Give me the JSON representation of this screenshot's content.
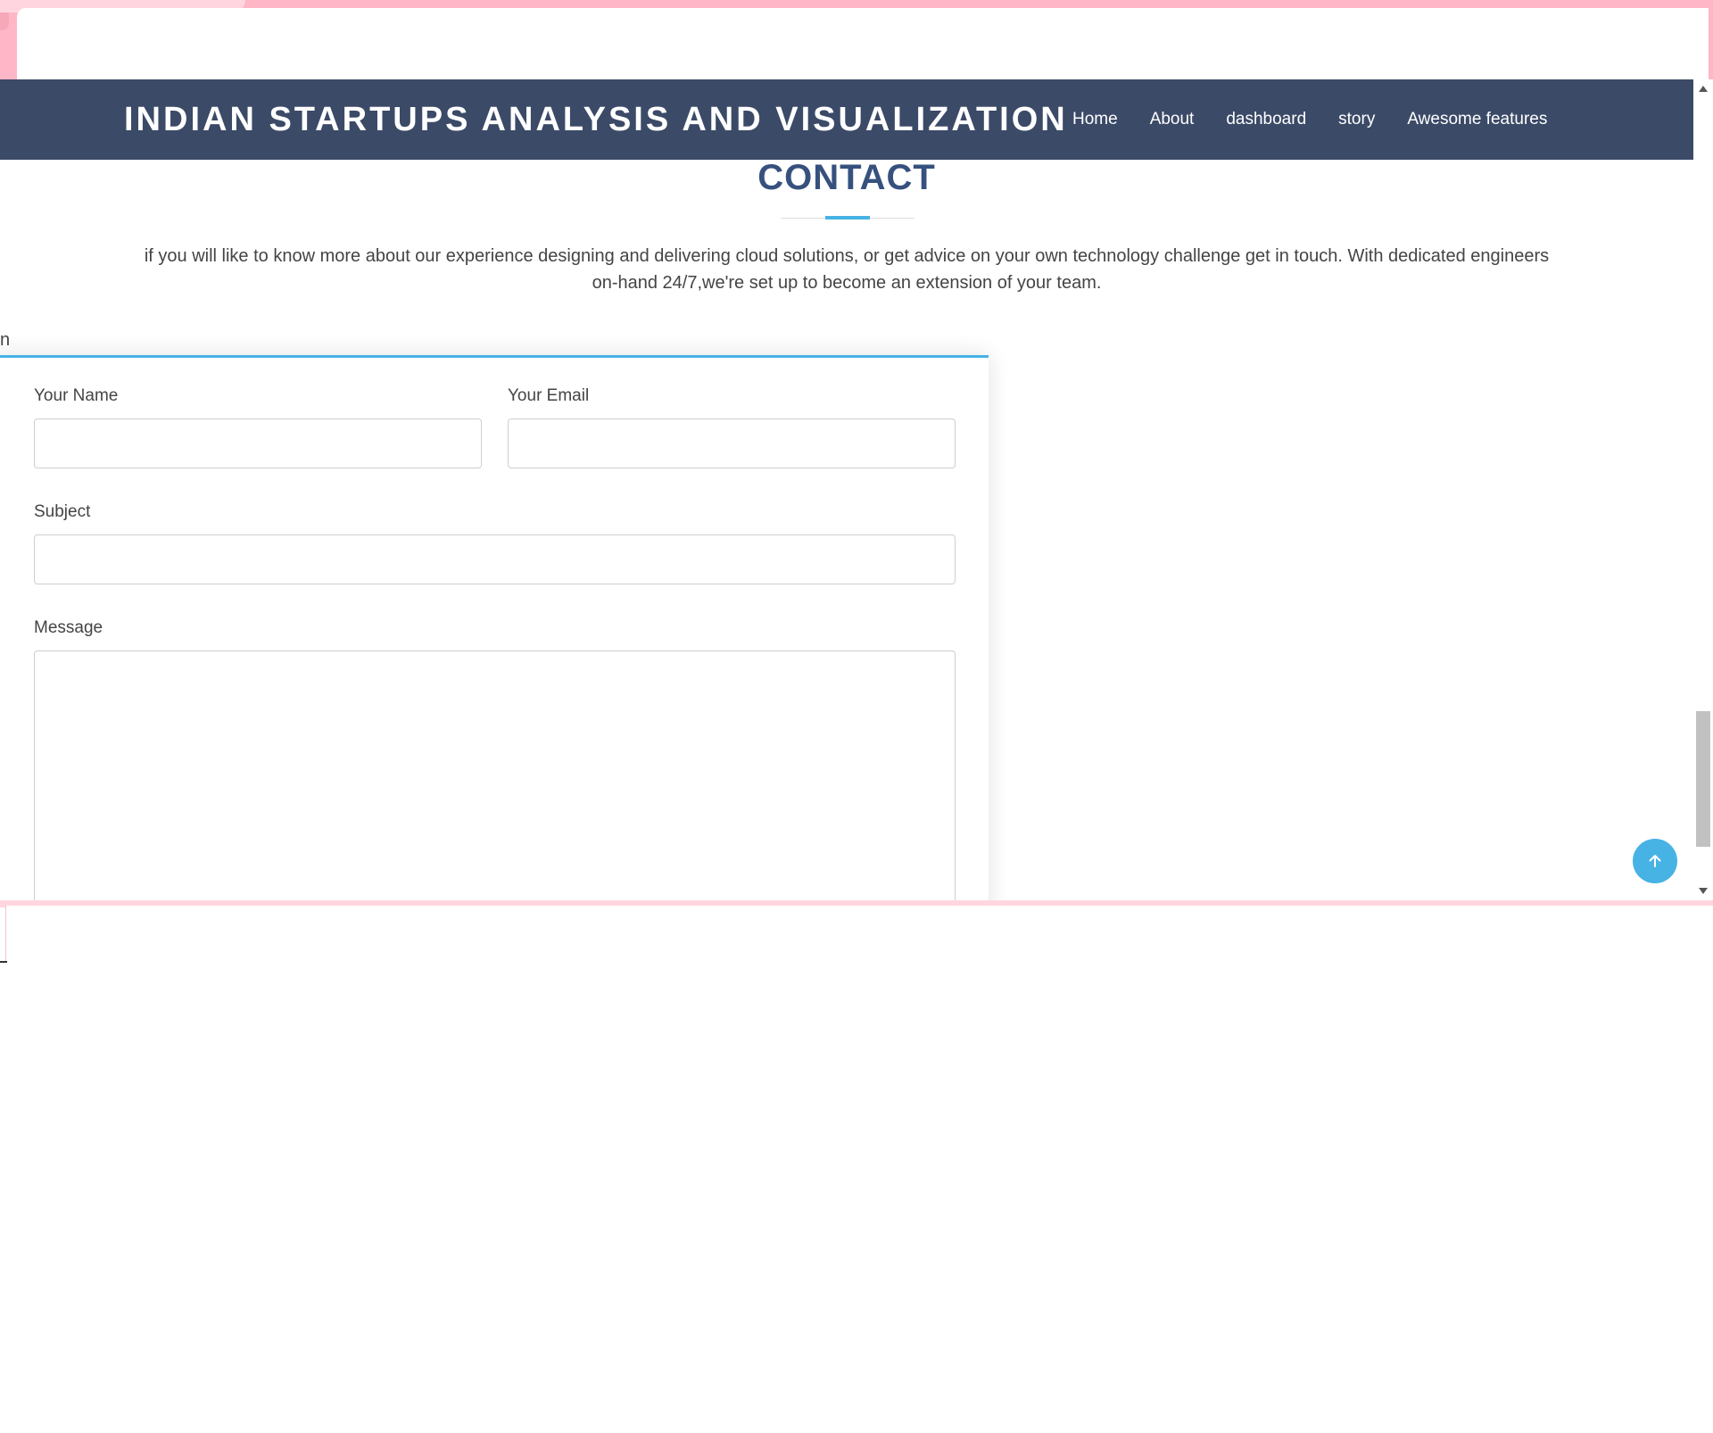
{
  "site": {
    "logo_text": "INDIAN STARTUPS ANALYSIS AND VISUALIZATION"
  },
  "nav": {
    "items": [
      {
        "label": "Home"
      },
      {
        "label": "About"
      },
      {
        "label": "dashboard"
      },
      {
        "label": "story"
      },
      {
        "label": "Awesome features"
      }
    ]
  },
  "contact": {
    "title": "CONTACT",
    "description": "if you will like to know more about our experience designing and delivering cloud solutions, or get advice on your own technology challenge get in touch. With dedicated engineers on-hand 24/7,we're set up to become an extension of your team.",
    "stray_text": "n"
  },
  "form": {
    "name": {
      "label": "Your Name",
      "value": ""
    },
    "email": {
      "label": "Your Email",
      "value": ""
    },
    "subject": {
      "label": "Subject",
      "value": ""
    },
    "message": {
      "label": "Message",
      "value": ""
    }
  },
  "icons": {
    "back_to_top": "arrow-up-icon"
  },
  "colors": {
    "header_bg": "#3b4a67",
    "title": "#37517e",
    "accent": "#47b2e4",
    "frame": "#ffb6c6"
  }
}
